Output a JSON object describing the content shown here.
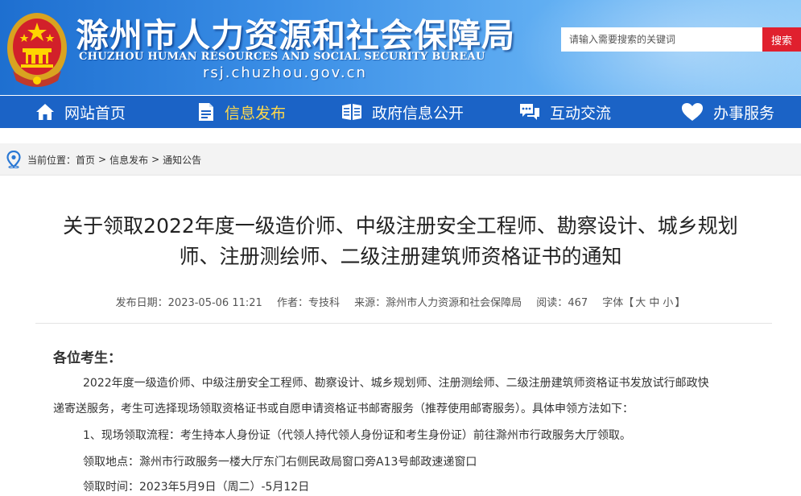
{
  "header": {
    "site_title": "滁州市人力资源和社会保障局",
    "site_title_en": "CHUZHOU HUMAN RESOURCES AND SOCIAL SECURITY BUREAU",
    "domain": "rsj.chuzhou.gov.cn",
    "search_placeholder": "请输入需要搜索的关键词",
    "search_button": "搜索",
    "emblem_icon": "national-emblem-icon"
  },
  "nav": {
    "items": [
      {
        "label": "网站首页",
        "icon": "home-icon"
      },
      {
        "label": "信息发布",
        "icon": "document-icon",
        "active": true
      },
      {
        "label": "政府信息公开",
        "icon": "book-icon"
      },
      {
        "label": "互动交流",
        "icon": "chat-icon"
      },
      {
        "label": "办事服务",
        "icon": "heart-icon"
      }
    ]
  },
  "breadcrumb": {
    "prefix": "当前位置：",
    "items": [
      "首页",
      "信息发布",
      "通知公告"
    ],
    "separator": ">",
    "icon": "location-pin-icon"
  },
  "article": {
    "title_line1": "关于领取2022年度一级造价师、中级注册安全工程师、勘察设计、城乡规划",
    "title_line2": "师、注册测绘师、二级注册建筑师资格证书的通知",
    "meta": {
      "date_label": "发布日期：",
      "date": "2023-05-06 11:21",
      "author_label": "作者：",
      "author": "专技科",
      "source_label": "来源：",
      "source": "滁州市人力资源和社会保障局",
      "views_label": "阅读：",
      "views": "467",
      "font_label": "字体【",
      "font_large": "大",
      "font_medium": "中",
      "font_small": "小",
      "font_close": "】"
    },
    "salutation": "各位考生：",
    "paragraph1_line1": "2022年度一级造价师、中级注册安全工程师、勘察设计、城乡规划师、注册测绘师、二级注册建筑师资格证书发放试行邮政快",
    "paragraph1_line2": "递寄送服务，考生可选择现场领取资格证书或自愿申请资格证书邮寄服务（推荐使用邮寄服务）。具体申领方法如下：",
    "paragraph2": "1、现场领取流程：考生持本人身份证（代领人持代领人身份证和考生身份证）前往滁州市行政服务大厅领取。",
    "paragraph3": "领取地点：滁州市行政服务一楼大厅东门右侧民政局窗口旁A13号邮政速递窗口",
    "paragraph4": "领取时间：2023年5月9日（周二）-5月12日"
  },
  "colors": {
    "nav_bg": "#1b63c6",
    "nav_active": "#ffd84a",
    "search_button": "#e0202e",
    "header_gradient_start": "#1e6fd0",
    "header_gradient_end": "#8fcaf8"
  }
}
